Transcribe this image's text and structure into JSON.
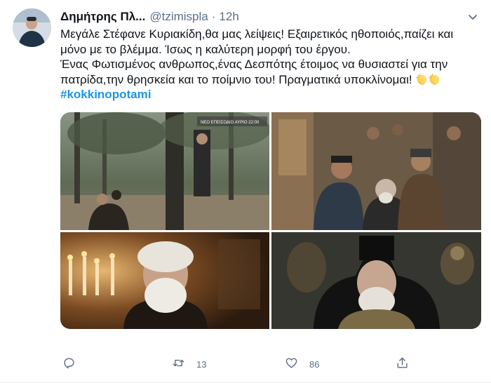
{
  "tweet": {
    "author_name": "Δημήτρης Πλ...",
    "handle": "@tzimispla",
    "separator": "·",
    "time": "12h",
    "text_lines": [
      "Μεγάλε Στέφανε Κυριακίδη,θα μας λείψεις! Εξαιρετικός ηθοποιός,παίζει και",
      "μόνο με το βλέμμα. Ίσως η καλύτερη μορφή του έργου.",
      "Ένας Φωτισμένος ανθρωπος,ένας Δεσπότης έτοιμος να θυσιαστεί για την",
      "πατρίδα,την θρησκεία και το ποίμνιο του! Πραγματικά υποκλίνομαι!"
    ],
    "emoji": [
      "clapping-hands-emoji",
      "clapping-hands-emoji"
    ],
    "hashtag": "#kokkinopotami",
    "media_overlay_text": "ΝΕΟ ΕΠΕΙΣΟΔΙΟ ΑΥΡΙΟ 22:00",
    "retweet_count": "13",
    "like_count": "86"
  },
  "colors": {
    "link": "#1b95e0",
    "secondary_text": "#5b7083",
    "primary_text": "#0f1419"
  },
  "icons": {
    "reply": "reply-icon",
    "retweet": "retweet-icon",
    "like": "heart-icon",
    "share": "share-icon",
    "more": "chevron-down-icon"
  }
}
